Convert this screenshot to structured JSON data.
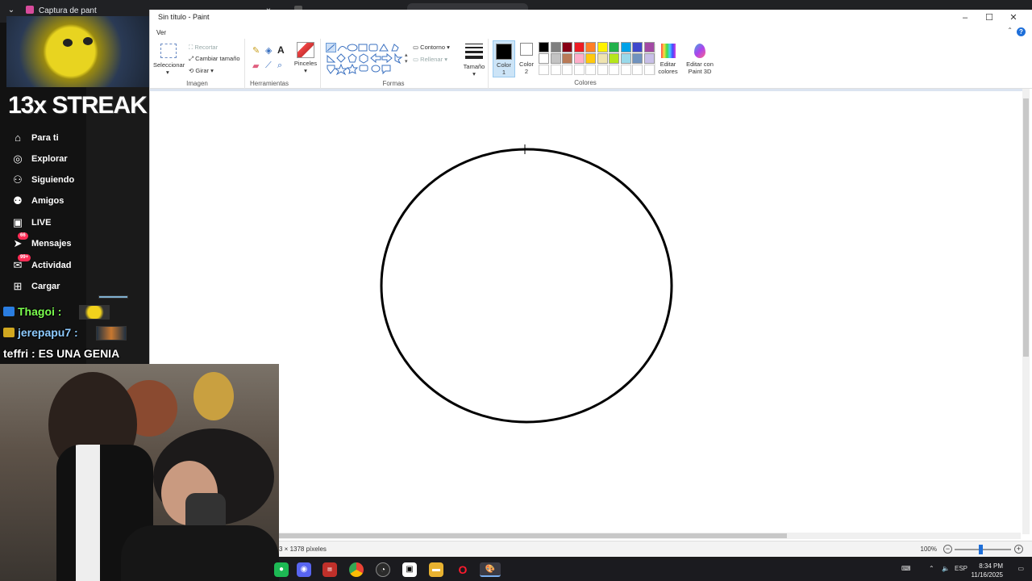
{
  "browser": {
    "tabs": [
      {
        "label": "Captura de pant",
        "color": "#d84b9c"
      },
      {
        "label": "",
        "color": "#a64dff"
      },
      {
        "label": "",
        "color": "#555555"
      }
    ]
  },
  "paint": {
    "title": "Sin título - Paint",
    "menu_ver": "Ver",
    "groups": {
      "seleccionar": "Seleccionar",
      "imagen": "Imagen",
      "recortar": "Recortar",
      "cambiar_tamano": "Cambiar tamaño",
      "girar": "Girar",
      "herramientas": "Herramientas",
      "pinceles": "Pinceles",
      "formas": "Formas",
      "contorno": "Contorno",
      "rellenar": "Rellenar",
      "tamano": "Tamaño",
      "color1": "Color\n1",
      "color2": "Color\n2",
      "colores": "Colores",
      "editar_colores": "Editar\ncolores",
      "editar_paint3d": "Editar con\nPaint 3D"
    },
    "palette": [
      "#000000",
      "#7f7f7f",
      "#880015",
      "#ed1c24",
      "#ff7f27",
      "#fff200",
      "#22b14c",
      "#00a2e8",
      "#3f48cc",
      "#a349a4",
      "#ffffff",
      "#c3c3c3",
      "#b97a57",
      "#ffaec9",
      "#ffc90e",
      "#efe4b0",
      "#b5e61d",
      "#99d9ea",
      "#7092be",
      "#c8bfe7"
    ],
    "status": {
      "dimensions": "3 × 1378 píxeles",
      "zoom": "100%"
    }
  },
  "overlay": {
    "streak": "13x STREAK",
    "nav": [
      {
        "label": "Para ti",
        "icon": "home-icon"
      },
      {
        "label": "Explorar",
        "icon": "compass-icon"
      },
      {
        "label": "Siguiendo",
        "icon": "following-icon"
      },
      {
        "label": "Amigos",
        "icon": "friends-icon"
      },
      {
        "label": "LIVE",
        "icon": "live-icon"
      },
      {
        "label": "Mensajes",
        "icon": "messages-icon",
        "badge": "66"
      },
      {
        "label": "Actividad",
        "icon": "activity-icon",
        "badge": "99+"
      },
      {
        "label": "Cargar",
        "icon": "upload-icon"
      }
    ],
    "chat": [
      {
        "user": "Thagoi",
        "text": "",
        "color": "#7cff4f"
      },
      {
        "user": "jerepapu7",
        "text": "",
        "color": "#8ecbff"
      },
      {
        "user": "teffri",
        "text": "ES UNA GENIA",
        "color": "#ffffff"
      }
    ]
  },
  "taskbar": {
    "lang": "ESP",
    "time": "8:34 PM",
    "date": "11/16/2025"
  }
}
